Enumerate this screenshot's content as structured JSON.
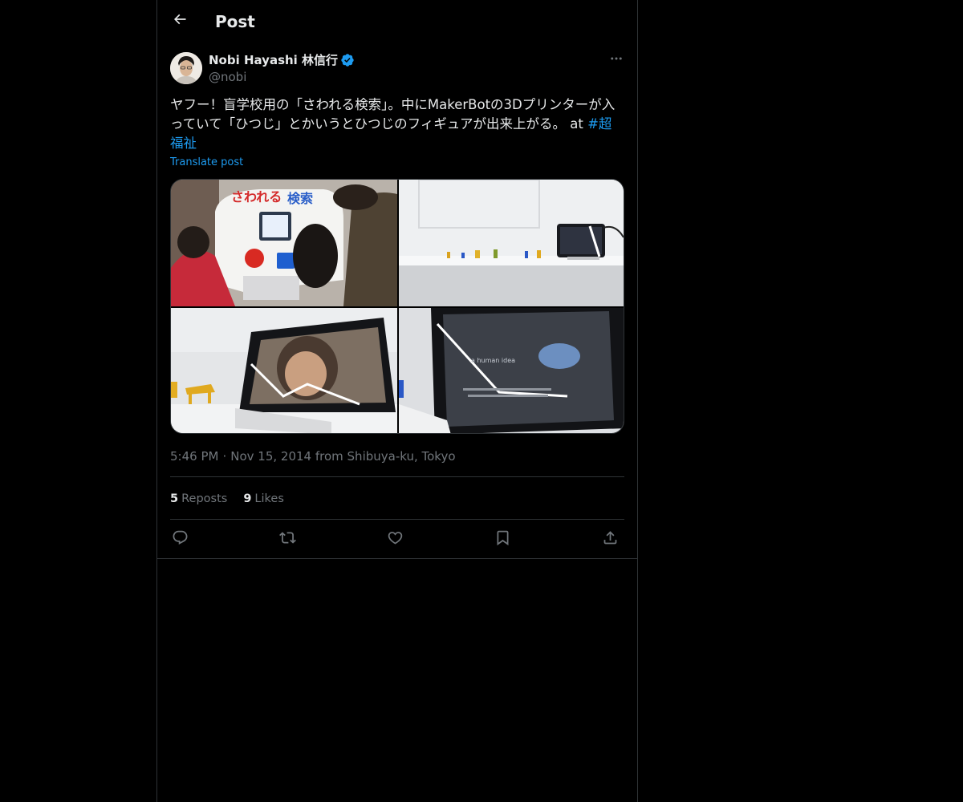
{
  "header": {
    "back_icon": "arrow-left-icon",
    "title": "Post"
  },
  "author": {
    "display_name": "Nobi Hayashi 林信行",
    "handle": "@nobi",
    "verified_icon": "verified-badge-icon",
    "more_icon": "more-horizontal-icon"
  },
  "tweet": {
    "text": "ヤフー！盲学校用の「さわれる検索」。中にMakerBotの3Dプリンターが入っていて「ひつじ」とかいうとひつじのフィギュアが出来上がる。 at ",
    "hashtag": "#超福祉",
    "translate_label": "Translate post",
    "media": [
      {
        "alt": "さわれる検索 kiosk with children",
        "overlay_text": "さわれる検索"
      },
      {
        "alt": "3D printed figures on shelf with tablet"
      },
      {
        "alt": "Tablet showing video beside horse figures"
      },
      {
        "alt": "Tablet screen showing video",
        "overlay_text": "a human idea"
      }
    ]
  },
  "meta": {
    "time": "5:46 PM",
    "separator": "·",
    "date": "Nov 15, 2014",
    "location": "from Shibuya-ku, Tokyo"
  },
  "stats": {
    "reposts_count": "5",
    "reposts_label": "Reposts",
    "likes_count": "9",
    "likes_label": "Likes"
  },
  "actions": [
    "reply-icon",
    "repost-icon",
    "like-icon",
    "bookmark-icon",
    "share-icon"
  ],
  "colors": {
    "background": "#000000",
    "text": "#e7e9ea",
    "muted": "#71767b",
    "accent": "#1d9bf0",
    "border": "#2f3336"
  }
}
